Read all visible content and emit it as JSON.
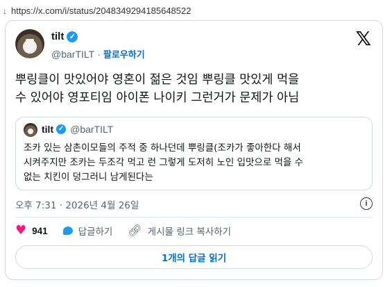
{
  "browser": {
    "url": "https://x.com/i/status/2048349294185648522"
  },
  "tweet": {
    "display_name": "tilt",
    "handle": "@barTILT",
    "separator": "·",
    "follow_label": "팔로우하기",
    "text": "뿌링클이 맛있어야 영혼이 젊은 것임 뿌링클 맛있게 먹을\n수 있어야 영포티임 아이폰 나이키 그런거가 문제가 아님",
    "timestamp": "오후 7:31 · 2026년 4월 26일",
    "likes": "941",
    "reply_label": "답글하기",
    "copy_link_label": "게시물 링크 복사하기",
    "read_replies_label": "1개의 답글 읽기"
  },
  "quote": {
    "display_name": "tilt",
    "handle": "@barTILT",
    "text": "조카 있는 삼촌이모들의 주적 중 하나던데 뿌링클(조카가 좋아한다 해서\n시켜주지만 조카는 두조각 먹고 런 그렇게 도저히 노인 입맛으로 먹을 수\n없는 치킨이 덩그러니 남게된다는"
  },
  "icons": {
    "download": "download-arrow-icon",
    "verified": "verified-badge-icon",
    "logo": "x-logo-icon",
    "info": "info-icon",
    "like": "heart-icon",
    "reply": "reply-bubble-icon",
    "link": "link-icon"
  },
  "colors": {
    "accent": "#1d9bf0",
    "link": "#006fd6",
    "like": "#f91880",
    "muted": "#536471",
    "border": "#cfd9de"
  }
}
